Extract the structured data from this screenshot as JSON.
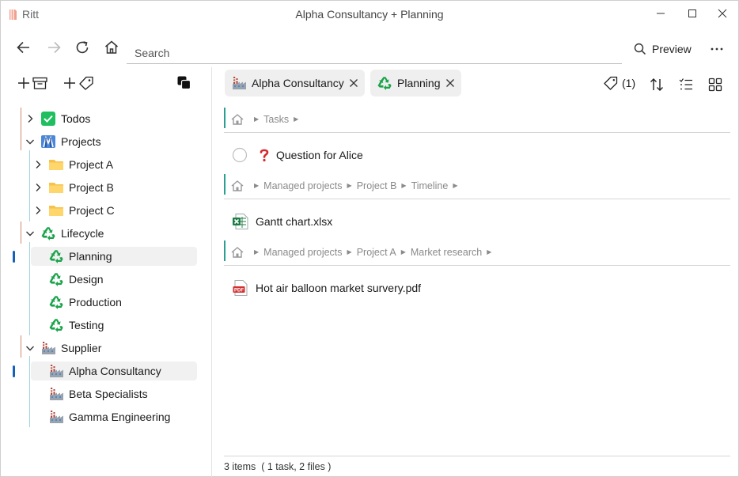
{
  "app": {
    "name": "Ritt",
    "window_title": "Alpha Consultancy + Planning"
  },
  "toolbar": {
    "search_placeholder": "Search",
    "preview_label": "Preview"
  },
  "sidebar": {
    "tree": [
      {
        "label": "Todos",
        "icon": "todo-check-icon",
        "expanded": false
      },
      {
        "label": "Projects",
        "icon": "projects-icon",
        "expanded": true
      },
      {
        "label": "Project A",
        "icon": "folder-icon",
        "expanded": false
      },
      {
        "label": "Project B",
        "icon": "folder-icon",
        "expanded": false
      },
      {
        "label": "Project C",
        "icon": "folder-icon",
        "expanded": false
      },
      {
        "label": "Lifecycle",
        "icon": "recycle-icon",
        "expanded": true
      },
      {
        "label": "Planning",
        "icon": "recycle-icon",
        "selected": true
      },
      {
        "label": "Design",
        "icon": "recycle-icon"
      },
      {
        "label": "Production",
        "icon": "recycle-icon"
      },
      {
        "label": "Testing",
        "icon": "recycle-icon"
      },
      {
        "label": "Supplier",
        "icon": "factory-icon",
        "expanded": true
      },
      {
        "label": "Alpha Consultancy",
        "icon": "factory-icon",
        "selected": true
      },
      {
        "label": "Beta Specialists",
        "icon": "factory-icon"
      },
      {
        "label": "Gamma Engineering",
        "icon": "factory-icon"
      }
    ]
  },
  "filters": {
    "chips": [
      {
        "label": "Alpha Consultancy",
        "icon": "factory-icon"
      },
      {
        "label": "Planning",
        "icon": "recycle-icon"
      }
    ],
    "tag_count": "(1)"
  },
  "groups": [
    {
      "crumbs": [
        "Tasks"
      ],
      "item": {
        "label": "Question for Alice",
        "icon": "question-icon"
      }
    },
    {
      "crumbs": [
        "Managed projects",
        "Project B",
        "Timeline"
      ],
      "item": {
        "label": "Gantt chart.xlsx",
        "icon": "excel-icon"
      }
    },
    {
      "crumbs": [
        "Managed projects",
        "Project A",
        "Market research"
      ],
      "item": {
        "label": "Hot air balloon market survery.pdf",
        "icon": "pdf-icon"
      }
    }
  ],
  "footer": {
    "status": "3 items  ( 1 task, 2 files )"
  },
  "colors": {
    "accent": "#1560b8",
    "tree_line": "#d08a6a",
    "crumb_bar": "#2b9f92",
    "recycle": "#1aa34a"
  }
}
